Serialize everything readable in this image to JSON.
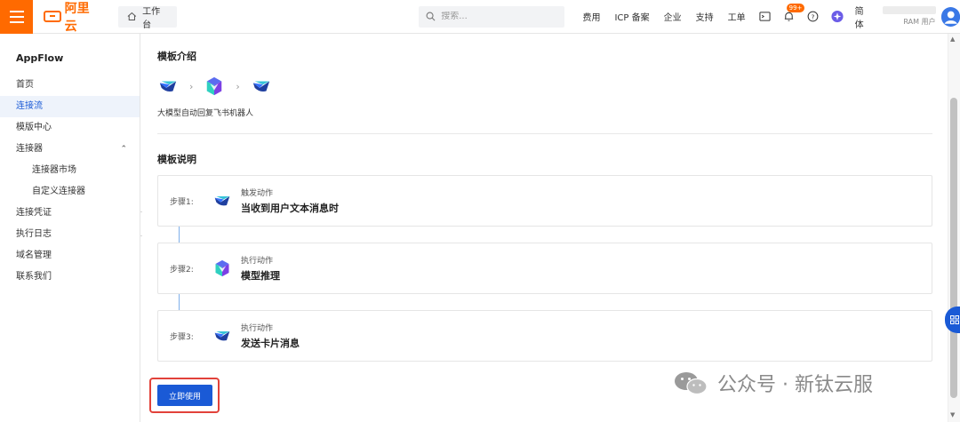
{
  "header": {
    "logo_text": "阿里云",
    "workbench_label": "工作台",
    "search_placeholder": "搜索...",
    "nav_links": [
      "费用",
      "ICP 备案",
      "企业",
      "支持",
      "工单"
    ],
    "notification_badge": "99+",
    "language": "简体",
    "user_role": "RAM 用户"
  },
  "sidebar": {
    "app_title": "AppFlow",
    "items": [
      {
        "label": "首页"
      },
      {
        "label": "连接流"
      },
      {
        "label": "模版中心"
      },
      {
        "label": "连接器"
      },
      {
        "label": "连接器市场"
      },
      {
        "label": "自定义连接器"
      },
      {
        "label": "连接凭证"
      },
      {
        "label": "执行日志"
      },
      {
        "label": "域名管理"
      },
      {
        "label": "联系我们"
      }
    ],
    "active_item": "连接流"
  },
  "main": {
    "intro_title": "模板介绍",
    "template_name": "大模型自动回复飞书机器人",
    "desc_title": "模板说明",
    "steps": [
      {
        "label": "步骤1:",
        "type": "触发动作",
        "name": "当收到用户文本消息时",
        "icon": "feishu-icon"
      },
      {
        "label": "步骤2:",
        "type": "执行动作",
        "name": "模型推理",
        "icon": "model-icon"
      },
      {
        "label": "步骤3:",
        "type": "执行动作",
        "name": "发送卡片消息",
        "icon": "feishu-icon"
      }
    ],
    "use_button": "立即使用"
  },
  "watermark": {
    "text": "公众号 · 新钛云服"
  },
  "colors": {
    "brand_orange": "#ff6a00",
    "primary_blue": "#1a5ad6",
    "highlight_red": "#e2423a",
    "active_bg": "#eef3fb"
  }
}
